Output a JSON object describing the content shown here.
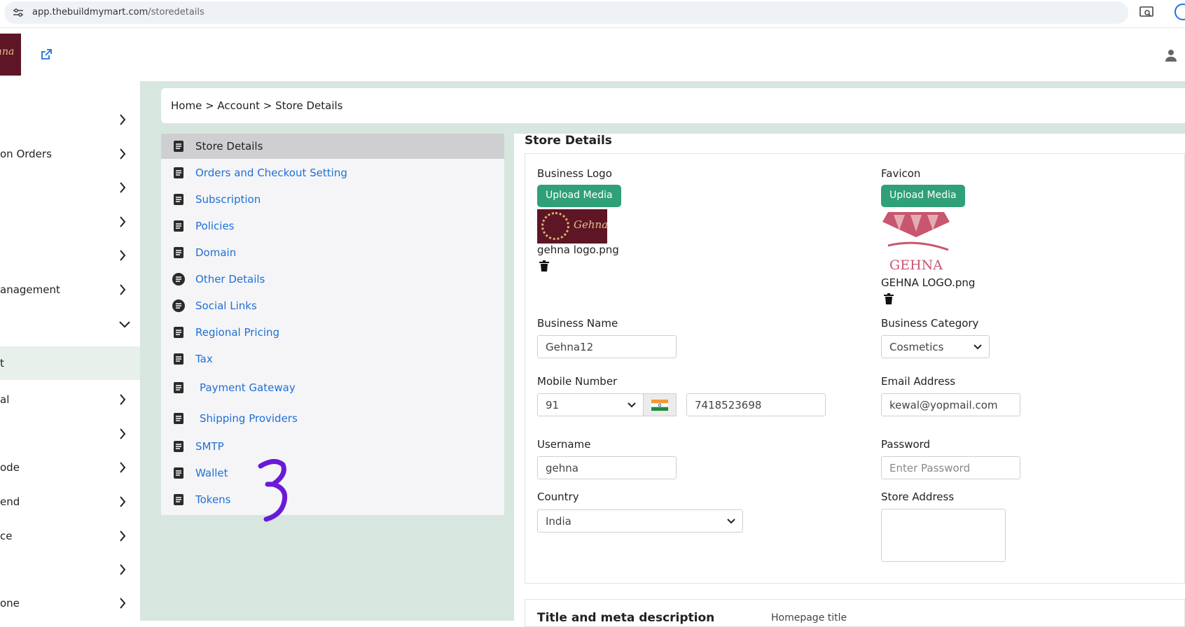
{
  "browser": {
    "url_host": "app.thebuildmymart.com",
    "url_path": "/storedetails"
  },
  "brand": {
    "logo_text": "hna"
  },
  "sidebar": {
    "items": [
      {
        "label": "",
        "expanded": false
      },
      {
        "label": "on Orders",
        "expanded": false
      },
      {
        "label": "",
        "expanded": false
      },
      {
        "label": "",
        "expanded": false
      },
      {
        "label": "",
        "expanded": false
      },
      {
        "label": "anagement",
        "expanded": false
      },
      {
        "label": "",
        "expanded": true
      },
      {
        "label": "t",
        "active": true
      },
      {
        "label": "al",
        "expanded": false
      },
      {
        "label": "",
        "expanded": false
      },
      {
        "label": "ode",
        "expanded": false
      },
      {
        "label": "end",
        "expanded": false
      },
      {
        "label": "ce",
        "expanded": false
      },
      {
        "label": "",
        "expanded": false
      },
      {
        "label": "one",
        "expanded": false
      }
    ]
  },
  "breadcrumb": {
    "text": "Home > Account > Store Details"
  },
  "account_menu": {
    "items": [
      {
        "label": "Store Details",
        "icon": "store-details-icon",
        "selected": true
      },
      {
        "label": "Orders and Checkout Setting",
        "icon": "orders-icon"
      },
      {
        "label": "Subscription",
        "icon": "subscription-icon"
      },
      {
        "label": "Policies",
        "icon": "policies-icon"
      },
      {
        "label": "Domain",
        "icon": "domain-icon"
      },
      {
        "label": "Other Details",
        "icon": "list-icon"
      },
      {
        "label": "Social Links",
        "icon": "link-icon"
      },
      {
        "label": "Regional Pricing",
        "icon": "globe-icon"
      },
      {
        "label": "Tax",
        "icon": "tax-icon"
      },
      {
        "label": "Payment Gateway",
        "icon": "payment-icon"
      },
      {
        "label": "Shipping Providers",
        "icon": "truck-icon"
      },
      {
        "label": "SMTP",
        "icon": "mail-box-icon"
      },
      {
        "label": "Wallet",
        "icon": "wallet-icon"
      },
      {
        "label": "Tokens",
        "icon": "token-icon"
      }
    ]
  },
  "store": {
    "title": "Store Details",
    "business_logo": {
      "label": "Business Logo",
      "button": "Upload Media",
      "filename": "gehna logo.png",
      "image_text": "Gehna"
    },
    "favicon": {
      "label": "Favicon",
      "button": "Upload Media",
      "filename": "GEHNA LOGO.png",
      "image_text": "GEHNA"
    },
    "business_name": {
      "label": "Business Name",
      "value": "Gehna12"
    },
    "business_category": {
      "label": "Business Category",
      "value": "Cosmetics"
    },
    "mobile": {
      "label": "Mobile Number",
      "country_code": "91",
      "number": "7418523698"
    },
    "email": {
      "label": "Email Address",
      "value": "kewal@yopmail.com"
    },
    "username": {
      "label": "Username",
      "value": "gehna"
    },
    "password": {
      "label": "Password",
      "placeholder": "Enter Password"
    },
    "country": {
      "label": "Country",
      "value": "India"
    },
    "store_address": {
      "label": "Store Address",
      "value": ""
    }
  },
  "meta": {
    "title": "Title and meta description",
    "homepage_title": "Homepage title"
  },
  "colors": {
    "accent": "#2fa077",
    "link": "#1f6fd6",
    "main_bg": "#d7e6df",
    "doodle": "#6a19d8"
  }
}
